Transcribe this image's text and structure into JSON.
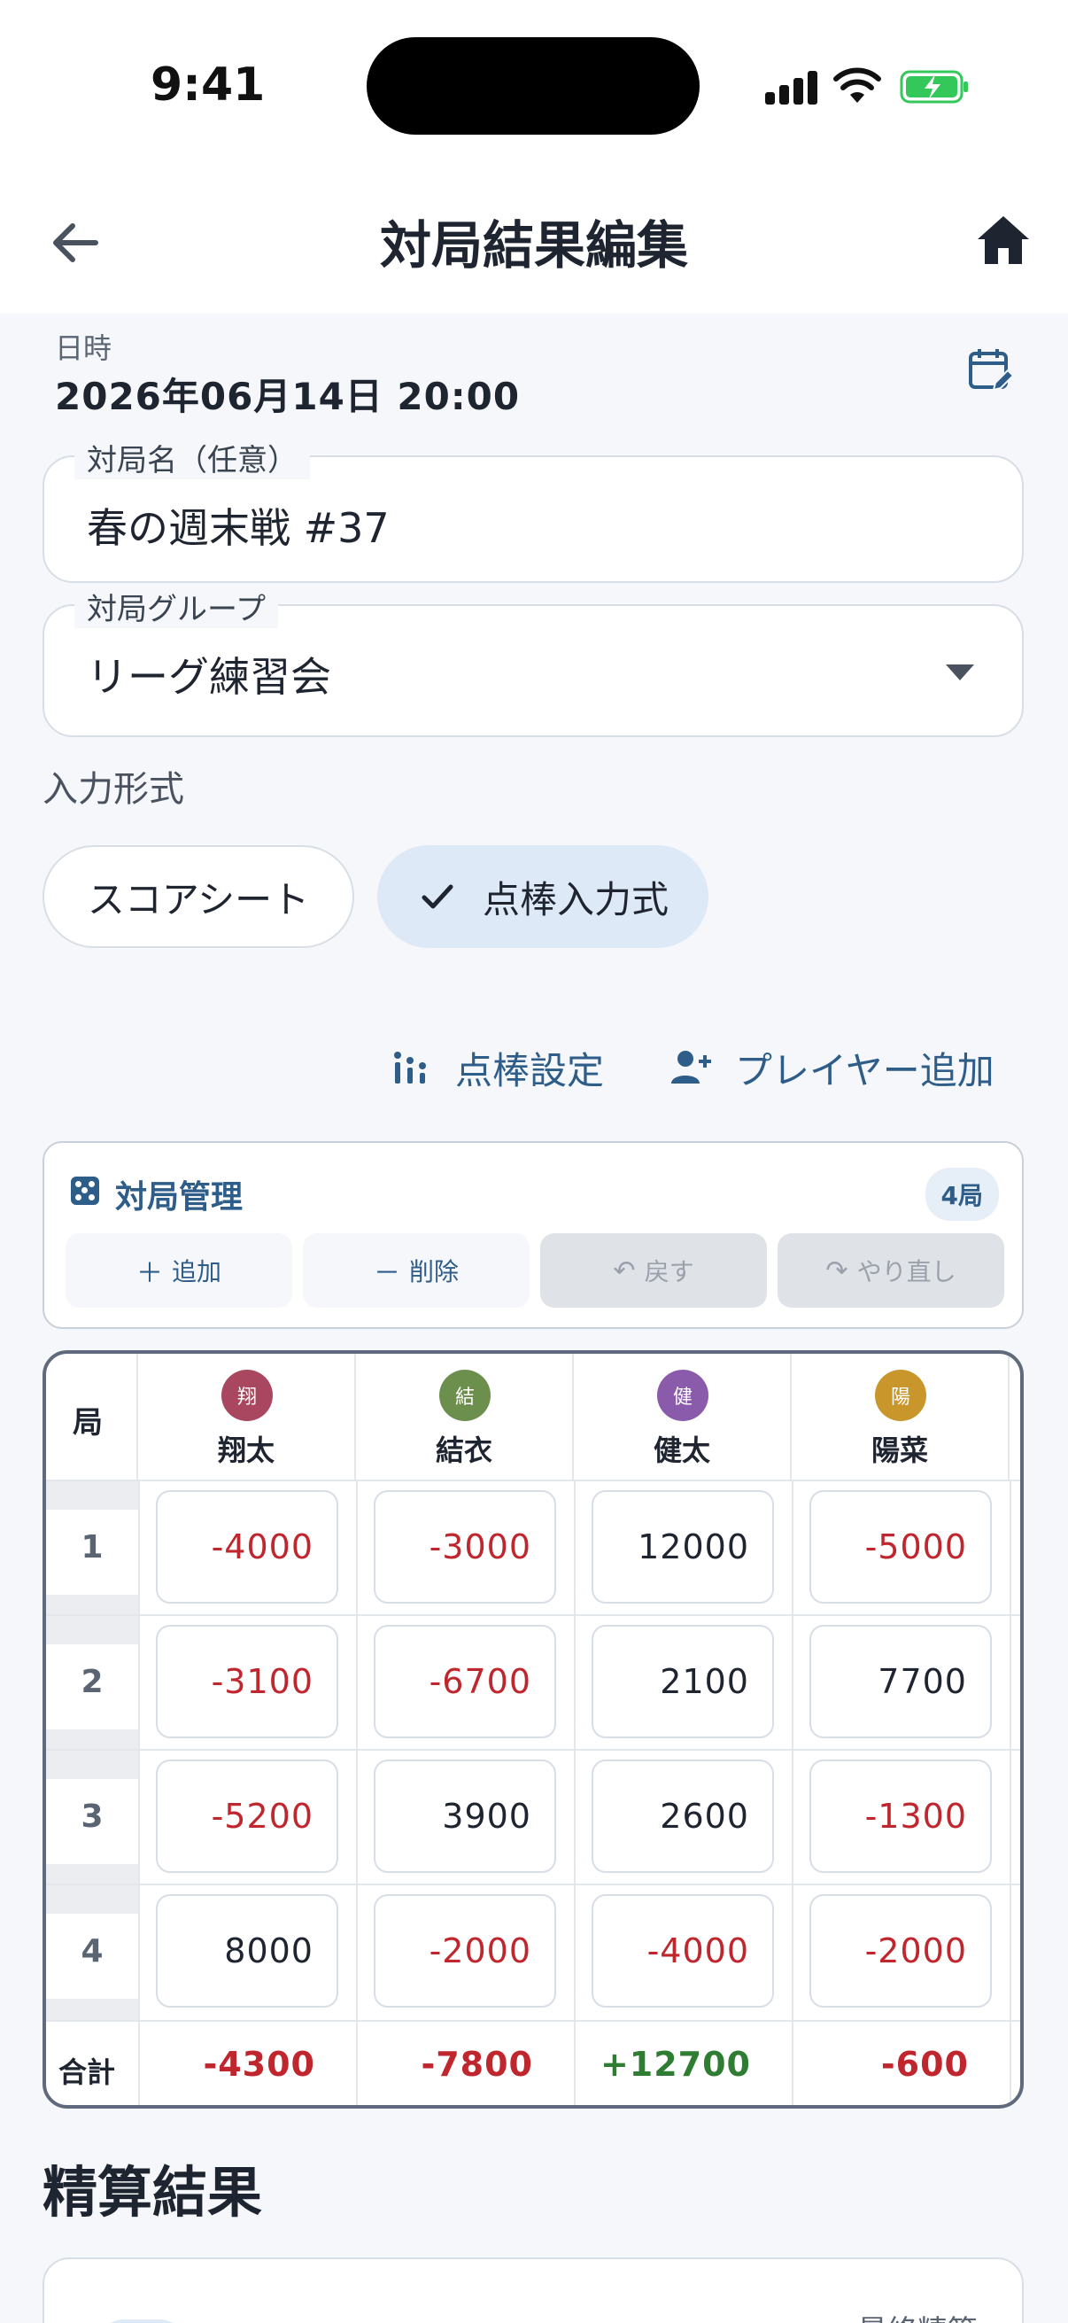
{
  "status": {
    "time": "9:41"
  },
  "appbar": {
    "title": "対局結果編集"
  },
  "date": {
    "label": "日時",
    "value": "2026年06月14日 20:00"
  },
  "game_name": {
    "label": "対局名（任意）",
    "value": "春の週末戦 #37"
  },
  "group": {
    "label": "対局グループ",
    "value": "リーグ練習会"
  },
  "input_mode": {
    "label": "入力形式",
    "options": [
      "スコアシート",
      "点棒入力式"
    ],
    "selected": "点棒入力式"
  },
  "actions": {
    "tenbou_settings": "点棒設定",
    "add_player": "プレイヤー追加"
  },
  "management": {
    "title": "対局管理",
    "count": "4局",
    "add": "追加",
    "delete": "削除",
    "undo": "戻す",
    "redo": "やり直し"
  },
  "table": {
    "kyoku_header": "局",
    "total_label": "合計",
    "players": [
      {
        "name": "翔太",
        "initial": "翔",
        "color": "#a8475f"
      },
      {
        "name": "結衣",
        "initial": "結",
        "color": "#6c8f4e"
      },
      {
        "name": "健太",
        "initial": "健",
        "color": "#8a5aab"
      },
      {
        "name": "陽菜",
        "initial": "陽",
        "color": "#c9962c"
      }
    ],
    "rows": [
      {
        "kyoku": "1",
        "scores": [
          "-4000",
          "-3000",
          "12000",
          "-5000"
        ]
      },
      {
        "kyoku": "2",
        "scores": [
          "-3100",
          "-6700",
          "2100",
          "7700"
        ]
      },
      {
        "kyoku": "3",
        "scores": [
          "-5200",
          "3900",
          "2600",
          "-1300"
        ]
      },
      {
        "kyoku": "4",
        "scores": [
          "8000",
          "-2000",
          "-4000",
          "-2000"
        ]
      }
    ],
    "totals": [
      "-4300",
      "-7800",
      "+12700",
      "-600"
    ]
  },
  "settlement": {
    "title": "精算結果",
    "final_label": "最終精算"
  }
}
